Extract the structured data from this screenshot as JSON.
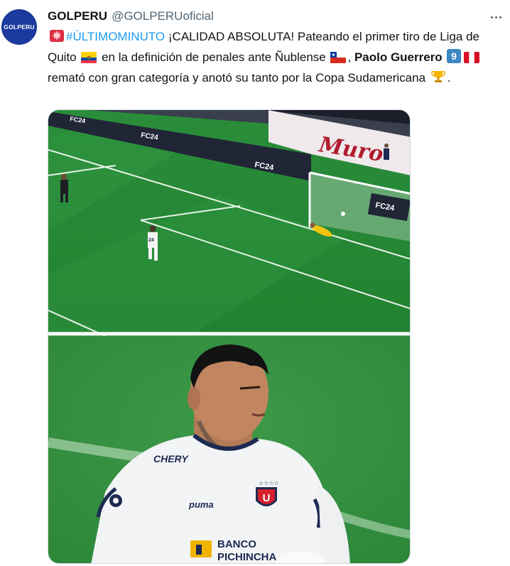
{
  "account": {
    "avatar_text": "GOLPERU",
    "display_name": "GOLPERU",
    "handle": "@GOLPERUoficial"
  },
  "tweet": {
    "hashtag": "#ÚLTIMOMINUTO",
    "part1": " ¡CALIDAD ABSOLUTA! Pateando el primer tiro de Liga de Quito ",
    "part2": " en la definición de penales ante Ñublense ",
    "part3": ", ",
    "player_name": "Paolo Guerrero",
    "number": "9",
    "part4": " remató con gran categoría y anotó su tanto por la Copa Sudamericana ",
    "part5": "."
  },
  "media": {
    "top_photo": {
      "ad_boards": [
        "FC24",
        "FC24",
        "FC24",
        "FC24"
      ],
      "player_number": "24",
      "banner_text": "Muro"
    },
    "bottom_photo": {
      "sponsor_chest": "CHERY",
      "sponsor_main_line1": "BANCO",
      "sponsor_main_line2": "PICHINCHA",
      "kit_brand": "puma",
      "crest_letter": "U"
    }
  },
  "icons": {
    "siren": "rotating-light-icon",
    "flag_ecuador": "ecuador-flag-icon",
    "flag_chile": "chile-flag-icon",
    "flag_peru": "peru-flag-icon",
    "keycap_nine": "keycap-nine-icon",
    "trophy": "trophy-icon",
    "more": "more-horizontal-icon"
  },
  "colors": {
    "hashtag": "#1d9bf0",
    "text": "#0f1419",
    "secondary": "#536471",
    "avatar_bg": "#1a3aa0"
  }
}
